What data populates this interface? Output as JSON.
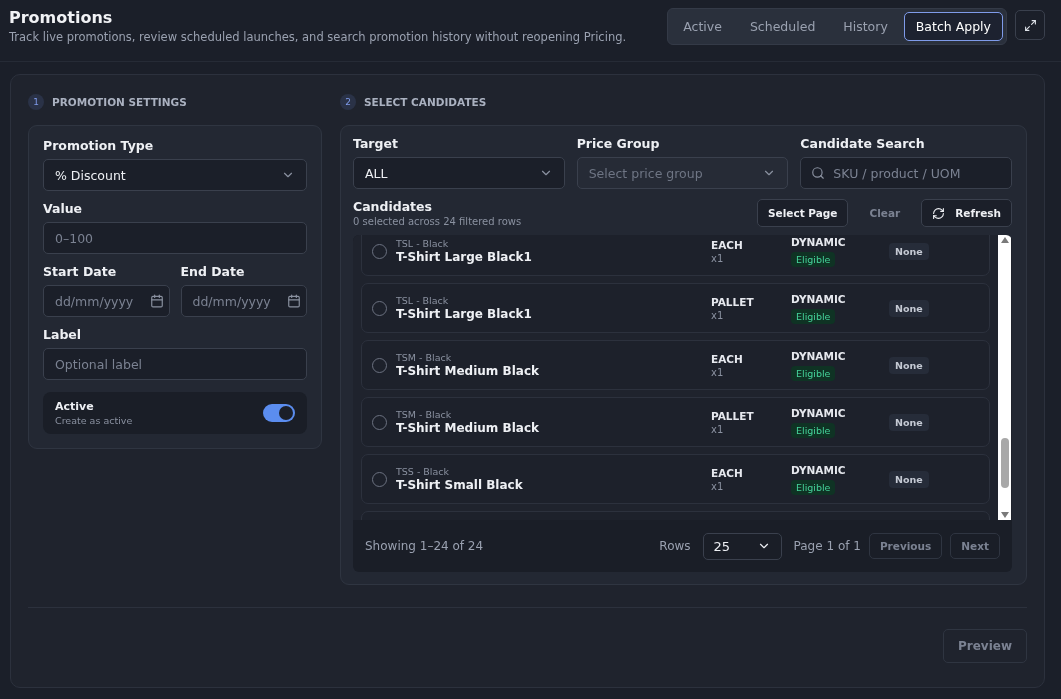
{
  "header": {
    "title": "Promotions",
    "subtitle": "Track live promotions, review scheduled launches, and search promotion history without reopening Pricing."
  },
  "tabs": [
    {
      "label": "Active",
      "selected": false
    },
    {
      "label": "Scheduled",
      "selected": false
    },
    {
      "label": "History",
      "selected": false
    },
    {
      "label": "Batch Apply",
      "selected": true
    }
  ],
  "settings": {
    "step": "1",
    "heading": "PROMOTION SETTINGS",
    "promotion_type": {
      "label": "Promotion Type",
      "value": "% Discount"
    },
    "value": {
      "label": "Value",
      "placeholder": "0–100"
    },
    "start_date": {
      "label": "Start Date",
      "placeholder": "dd/mm/yyyy"
    },
    "end_date": {
      "label": "End Date",
      "placeholder": "dd/mm/yyyy"
    },
    "label_field": {
      "label": "Label",
      "placeholder": "Optional label"
    },
    "active": {
      "title": "Active",
      "hint": "Create as active",
      "on": true
    }
  },
  "candidates": {
    "step": "2",
    "heading": "SELECT CANDIDATES",
    "target": {
      "label": "Target",
      "value": "ALL"
    },
    "price_group": {
      "label": "Price Group",
      "placeholder": "Select price group",
      "disabled": true
    },
    "search": {
      "label": "Candidate Search",
      "placeholder": "SKU / product / UOM"
    },
    "title": "Candidates",
    "summary": "0 selected across 24 filtered rows",
    "buttons": {
      "select_page": "Select Page",
      "clear": "Clear",
      "refresh": "Refresh"
    },
    "rows": [
      {
        "code": "TSL - Black",
        "name": "T-Shirt Large Black1",
        "uom": "EACH",
        "qty": "x1",
        "pricing": "DYNAMIC",
        "status": "Eligible",
        "promo": "None",
        "selected": false
      },
      {
        "code": "TSL - Black",
        "name": "T-Shirt Large Black1",
        "uom": "PALLET",
        "qty": "x1",
        "pricing": "DYNAMIC",
        "status": "Eligible",
        "promo": "None",
        "selected": false
      },
      {
        "code": "TSM - Black",
        "name": "T-Shirt Medium Black",
        "uom": "EACH",
        "qty": "x1",
        "pricing": "DYNAMIC",
        "status": "Eligible",
        "promo": "None",
        "selected": false
      },
      {
        "code": "TSM - Black",
        "name": "T-Shirt Medium Black",
        "uom": "PALLET",
        "qty": "x1",
        "pricing": "DYNAMIC",
        "status": "Eligible",
        "promo": "None",
        "selected": false
      },
      {
        "code": "TSS - Black",
        "name": "T-Shirt Small Black",
        "uom": "EACH",
        "qty": "x1",
        "pricing": "DYNAMIC",
        "status": "Eligible",
        "promo": "None",
        "selected": false
      }
    ],
    "footer": {
      "showing": "Showing 1–24 of 24",
      "rows_label": "Rows",
      "rows_value": "25",
      "page": "Page 1 of 1",
      "previous": "Previous",
      "next": "Next"
    }
  },
  "preview": "Preview"
}
